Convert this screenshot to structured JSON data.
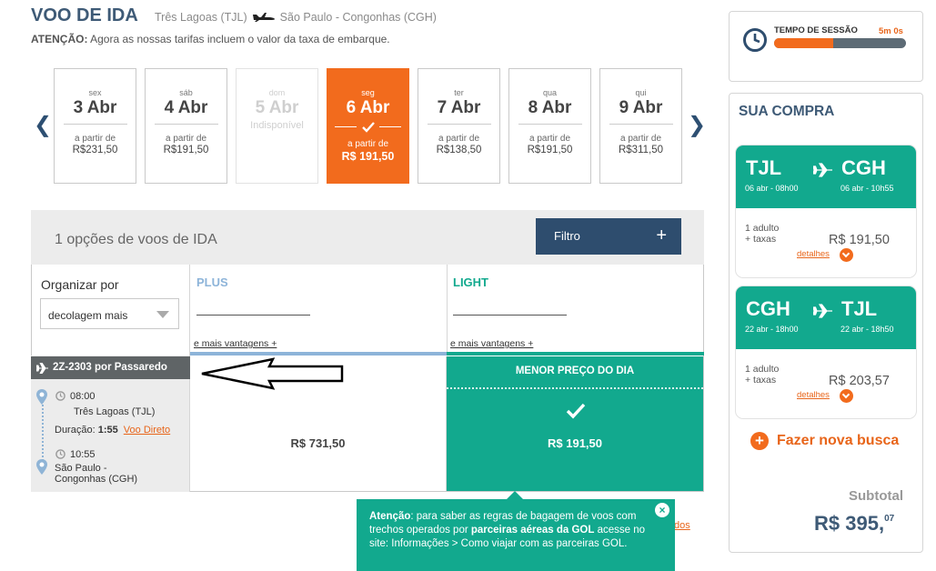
{
  "header": {
    "title": "VOO DE IDA",
    "origin": "Três Lagoas  (TJL)",
    "destination": "São Paulo - Congonhas  (CGH)",
    "notice_label": "ATENÇÃO:",
    "notice_text": " Agora as nossas tarifas incluem o valor da taxa de embarque."
  },
  "dates": [
    {
      "dow": "sex",
      "day": "3 Abr",
      "from": "a partir de",
      "price": "R$231,50",
      "state": "normal"
    },
    {
      "dow": "sáb",
      "day": "4 Abr",
      "from": "a partir de",
      "price": "R$191,50",
      "state": "normal"
    },
    {
      "dow": "dom",
      "day": "5 Abr",
      "unavailable": "Indisponível",
      "state": "disabled"
    },
    {
      "dow": "seg",
      "day": "6 Abr",
      "from": "a partir de",
      "price": "R$ 191,50",
      "state": "selected"
    },
    {
      "dow": "ter",
      "day": "7 Abr",
      "from": "a partir de",
      "price": "R$138,50",
      "state": "normal"
    },
    {
      "dow": "qua",
      "day": "8 Abr",
      "from": "a partir de",
      "price": "R$191,50",
      "state": "normal"
    },
    {
      "dow": "qui",
      "day": "9 Abr",
      "from": "a partir de",
      "price": "R$311,50",
      "state": "normal"
    }
  ],
  "options": {
    "title": "1 opções de voos de IDA",
    "filter_label": "Filtro",
    "filter_icon": "+"
  },
  "sort": {
    "label": "Organizar por",
    "selected": "decolagem mais"
  },
  "fares": {
    "plus": {
      "name": "PLUS",
      "more": "e mais vantagens +",
      "color": "#8db4d9"
    },
    "light": {
      "name": "LIGHT",
      "more": "e mais vantagens +",
      "color": "#12a98e"
    }
  },
  "flight": {
    "code": "2Z-2303 por  Passaredo",
    "dep_time": "08:00",
    "dep_place": "Três Lagoas (TJL)",
    "duration_label": "Duração:",
    "duration": "1:55",
    "direct": "Voo Direto",
    "arr_time": "10:55",
    "arr_place_1": "São Paulo -",
    "arr_place_2": "Congonhas (CGH)",
    "plus_price": "R$ 731,50",
    "light_banner": "MENOR  PREÇO DO DIA",
    "light_price": "R$ 191,50"
  },
  "tooltip": {
    "bold1": "Atenção",
    "text1": ": para saber as regras de bagagem de voos com trechos operados por ",
    "bold2": "parceiras aéreas da GOL",
    "text2": " acesse no site: Informações > Como viajar com as parceiras GOL.",
    "close": "×",
    "peek": "dos"
  },
  "session": {
    "label": "TEMPO DE SESSÃO",
    "time": "5m 0s",
    "progress": 0.45
  },
  "purchase": {
    "title": "SUA COMPRA",
    "legs": [
      {
        "from": "TJL",
        "to": "CGH",
        "dfrom": "06 abr - 08h00",
        "dto": "06 abr - 10h55",
        "pax1": "1 adulto",
        "pax2": "+ taxas",
        "price": "R$ 191,50",
        "details": "detalhes"
      },
      {
        "from": "CGH",
        "to": "TJL",
        "dfrom": "22 abr - 18h00",
        "dto": "22 abr - 18h50",
        "pax1": "1 adulto",
        "pax2": "+ taxas",
        "price": "R$ 203,57",
        "details": "detalhes"
      }
    ],
    "new_search": "Fazer nova busca",
    "subtotal_label": "Subtotal",
    "subtotal_main": "R$ 395,",
    "subtotal_cents": "07"
  },
  "colors": {
    "brand_orange": "#f26b1d",
    "brand_green": "#12a98e",
    "navy": "#2e4d6e"
  }
}
